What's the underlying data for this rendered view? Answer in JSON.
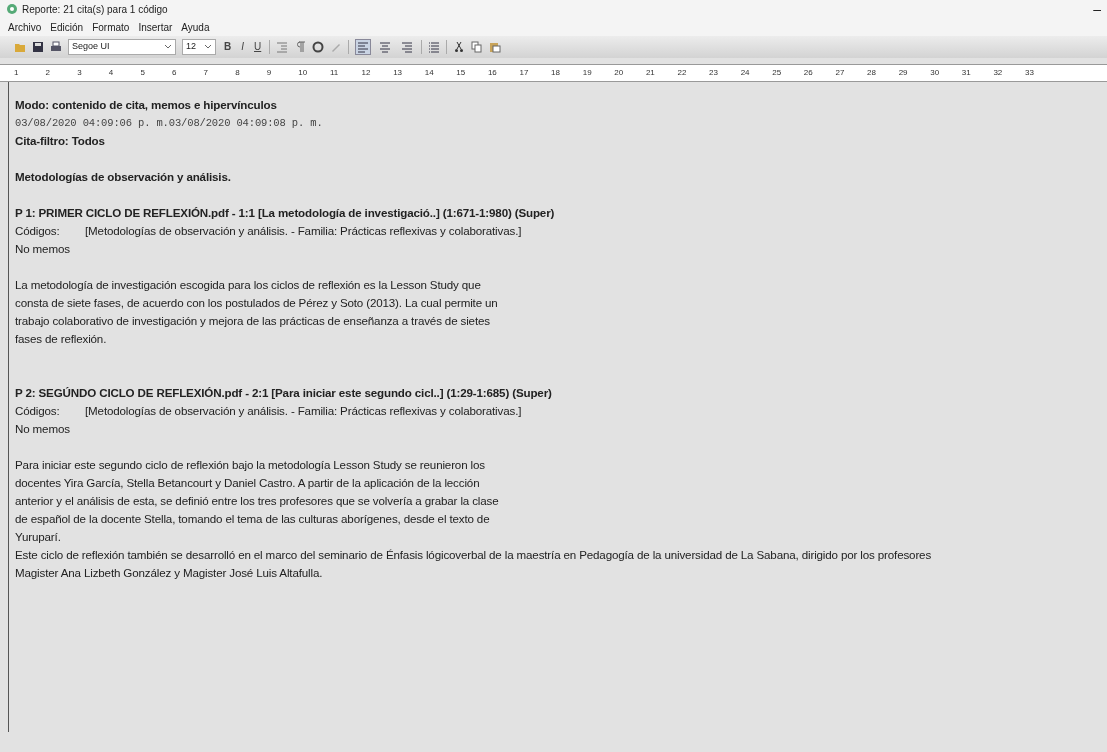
{
  "window": {
    "title": "Reporte: 21 cita(s) para 1 código",
    "minimize": "–"
  },
  "menu": [
    "Archivo",
    "Edición",
    "Formato",
    "Insertar",
    "Ayuda"
  ],
  "toolbar": {
    "font": "Segoe UI",
    "size": "12",
    "format_buttons": [
      "B",
      "I",
      "U"
    ],
    "align": [
      {
        "selected": true
      },
      {
        "selected": false
      },
      {
        "selected": false
      }
    ]
  },
  "ruler": [
    "1",
    "2",
    "3",
    "4",
    "5",
    "6",
    "7",
    "8",
    "9",
    "10",
    "11",
    "12",
    "13",
    "14",
    "15",
    "16",
    "17",
    "18",
    "19",
    "20",
    "21",
    "22",
    "23",
    "24",
    "25",
    "26",
    "27",
    "28",
    "29",
    "30",
    "31",
    "32",
    "33"
  ],
  "report": {
    "mode": "Modo: contenido de cita, memos e hipervínculos",
    "dates": "03/08/2020 04:09:06 p. m.03/08/2020 04:09:08 p. m.",
    "filter": "Cita-filtro: Todos",
    "code": "Metodologías de observación y análisis.",
    "quotes": [
      {
        "title": "P 1: PRIMER CICLO DE REFLEXIÓN.pdf - 1:1 [La metodología de investigació..]  (1:671-1:980)   (Super)",
        "codes_label": "Códigos:",
        "codes": "[Metodologías de observación y análisis. - Familia: Prácticas reflexivas y colaborativas.]",
        "memos": "No memos",
        "lines": [
          "La metodología de investigación escogida para los ciclos de reflexión es la Lesson Study que",
          "consta de siete fases, de acuerdo con los postulados de Pérez y Soto (2013). La cual permite un",
          "trabajo colaborativo de investigación y mejora de las prácticas de enseñanza a través de sietes",
          "fases de reflexión."
        ]
      },
      {
        "title": "P 2: SEGÚNDO CICLO DE REFLEXIÓN.pdf - 2:1 [Para iniciar este segundo cicl..]  (1:29-1:685)   (Super)",
        "codes_label": "Códigos:",
        "codes": "[Metodologías de observación y análisis. - Familia: Prácticas reflexivas y colaborativas.]",
        "memos": "No memos",
        "lines": [
          "Para iniciar este segundo ciclo de reflexión bajo la metodología Lesson Study se reunieron los",
          "docentes Yira García, Stella Betancourt y Daniel Castro. A partir de la aplicación de la lección",
          "anterior y el análisis de esta, se definió entre los tres profesores que se volvería a grabar la clase",
          "de español de la docente Stella, tomando el tema de las culturas aborígenes, desde el texto de",
          "Yuruparí.",
          "Este ciclo de reflexión también se desarrolló en el marco del seminario de Énfasis lógicoverbal de la maestría en Pedagogía de la universidad de La Sabana, dirigido por los profesores",
          "Magister Ana Lizbeth González y Magister José Luis Altafulla."
        ]
      }
    ]
  }
}
